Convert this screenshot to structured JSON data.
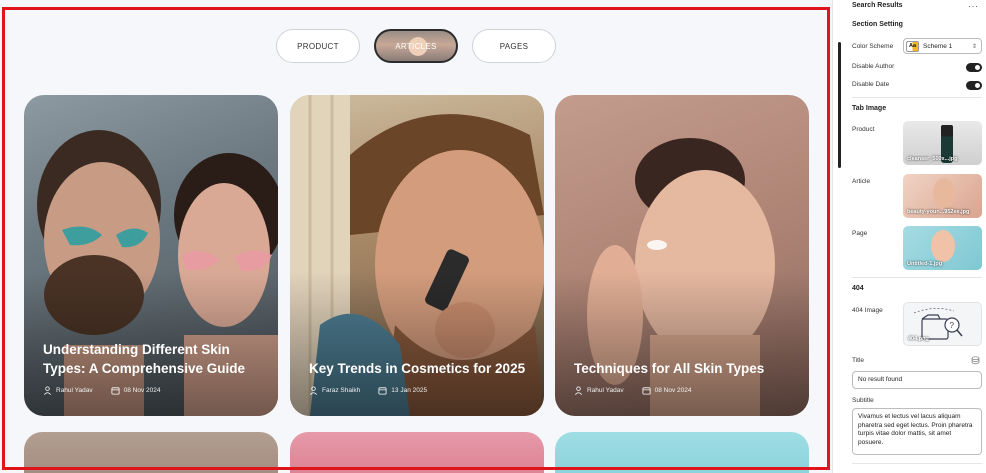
{
  "tabs": [
    {
      "label": "PRODUCT",
      "active": false
    },
    {
      "label": "ARTICLES",
      "active": true
    },
    {
      "label": "PAGES",
      "active": false
    }
  ],
  "cards": [
    {
      "title": "Understanding Different Skin Types: A Comprehensive Guide",
      "author": "Rahul Yadav",
      "date": "08 Nov 2024"
    },
    {
      "title": "Key Trends in Cosmetics for 2025",
      "author": "Faraz Shaikh",
      "date": "13 Jan 2025"
    },
    {
      "title": "Techniques for All Skin Types",
      "author": "Rahul Yadav",
      "date": "08 Nov 2024"
    }
  ],
  "panel": {
    "title": "Search Results",
    "more": "···",
    "section_setting": "Section Setting",
    "color_scheme_label": "Color Scheme",
    "color_scheme_value": "Scheme 1",
    "swatch_text": "Aa",
    "disable_author_label": "Disable Author",
    "disable_author": true,
    "disable_date_label": "Disable Date",
    "disable_date": true,
    "tab_image_heading": "Tab Image",
    "product_label": "Product",
    "product_file": "cleanser_500x...jpg",
    "article_label": "Article",
    "article_file": "beauty-youn...952ee.jpg",
    "page_label": "Page",
    "page_file": "Untitled-1.jpg",
    "heading_404": "404",
    "image_404_label": "404 Image",
    "image_404_file": "404.png",
    "title_label": "Title",
    "title_value": "No result found",
    "subtitle_label": "Subtitle",
    "subtitle_value": "Vivamus et lectus vel lacus aliquam pharetra sed eget lectus. Proin pharetra turpis vitae dolor mattis, sit amet posuere."
  },
  "colors": {
    "accent": "#e0151c",
    "toggle": "#222222"
  }
}
